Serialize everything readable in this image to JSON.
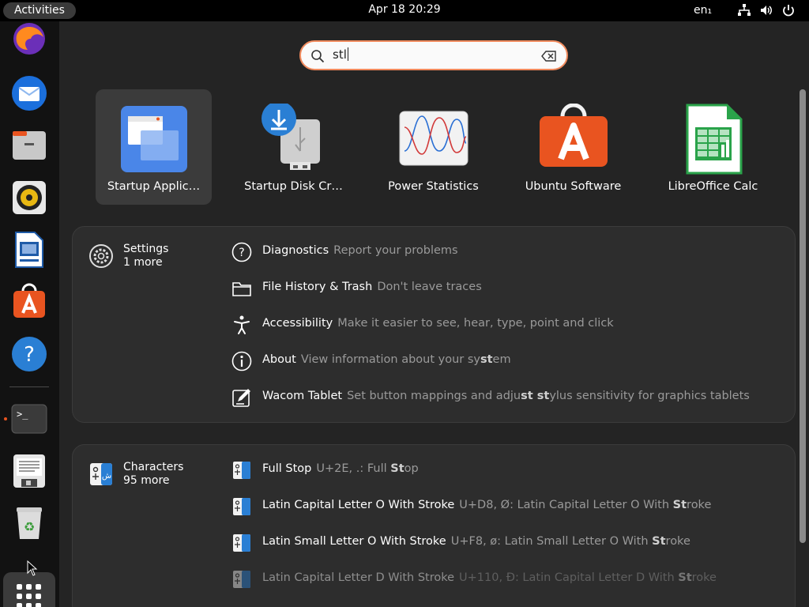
{
  "topbar": {
    "activities": "Activities",
    "clock": "Apr 18  20:29",
    "lang": "en₁",
    "tray_icons": [
      "network-icon",
      "volume-icon",
      "power-icon"
    ]
  },
  "dock": {
    "items": [
      {
        "name": "firefox-icon"
      },
      {
        "name": "thunderbird-icon"
      },
      {
        "name": "files-icon"
      },
      {
        "name": "rhythmbox-icon"
      },
      {
        "name": "libreoffice-writer-icon"
      },
      {
        "name": "ubuntu-software-icon"
      },
      {
        "name": "help-icon"
      },
      {
        "name": "terminal-icon",
        "running": true
      },
      {
        "name": "text-editor-icon"
      },
      {
        "name": "trash-icon"
      }
    ],
    "show_apps": "show-applications-icon"
  },
  "search": {
    "value": "stl",
    "typed": "st",
    "caret_after": "l"
  },
  "apps": [
    {
      "label": "Startup Applic…",
      "icon": "startup-applications-icon",
      "selected": true
    },
    {
      "label": "Startup Disk Cr…",
      "icon": "startup-disk-creator-icon",
      "selected": false
    },
    {
      "label": "Power Statistics",
      "icon": "power-statistics-icon",
      "selected": false
    },
    {
      "label": "Ubuntu Software",
      "icon": "ubuntu-software-icon",
      "selected": false
    },
    {
      "label": "LibreOffice Calc",
      "icon": "libreoffice-calc-icon",
      "selected": false
    }
  ],
  "settings": {
    "name": "Settings",
    "more": "1 more",
    "results": [
      {
        "icon": "help-circle-icon",
        "title": "Diagnostics",
        "desc": "Report your problems"
      },
      {
        "icon": "folder-icon",
        "title": "File History & Trash",
        "desc": "Don't leave traces"
      },
      {
        "icon": "accessibility-icon",
        "title": "Accessibility",
        "desc": "Make it easier to see, hear, type, point and click"
      },
      {
        "icon": "info-icon",
        "title": "About",
        "desc_pre": "View information about your sy",
        "desc_hl": "st",
        "desc_post": "em"
      },
      {
        "icon": "wacom-tablet-icon",
        "title": "Wacom Tablet",
        "desc_pre": "Set button mappings and adju",
        "desc_hl": "st st",
        "desc_post": "ylus sensitivity for graphics tablets"
      }
    ]
  },
  "characters": {
    "name": "Characters",
    "more": "95 more",
    "results": [
      {
        "icon": "characters-icon",
        "title": "Full Stop",
        "desc_pre": "U+2E, .: Full ",
        "desc_hl": "St",
        "desc_post": "op"
      },
      {
        "icon": "characters-icon",
        "title": "Latin Capital Letter O With Stroke",
        "desc_pre": "U+D8, Ø: Latin Capital Letter O With ",
        "desc_hl": "St",
        "desc_post": "roke"
      },
      {
        "icon": "characters-icon",
        "title": "Latin Small Letter O With Stroke",
        "desc_pre": "U+F8, ø: Latin Small Letter O With ",
        "desc_hl": "St",
        "desc_post": "roke"
      },
      {
        "icon": "characters-icon",
        "title": "Latin Capital Letter D With Stroke",
        "desc_pre": "U+110, Đ: Latin Capital Letter D With ",
        "desc_hl": "St",
        "desc_post": "roke"
      }
    ]
  },
  "colors": {
    "accent": "#e95420",
    "search_border": "#f08a5d"
  }
}
